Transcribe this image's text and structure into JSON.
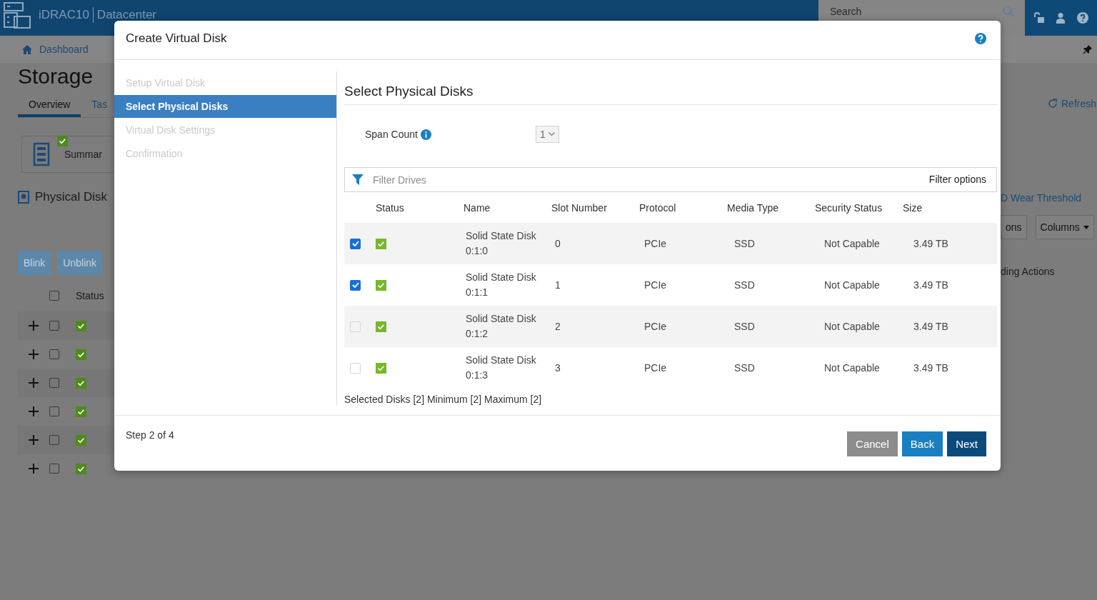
{
  "header": {
    "product": "iDRAC10",
    "edition": "Datacenter",
    "search": {
      "placeholder": "Search"
    }
  },
  "nav": {
    "items": [
      {
        "label": "Dashboard"
      }
    ]
  },
  "page": {
    "title": "Storage",
    "tabs": [
      {
        "label": "Overview",
        "selected": true
      },
      {
        "label": "Tas",
        "selected": false
      }
    ],
    "refresh": "Refresh",
    "summary_card": {
      "label": "Summar"
    },
    "section_title": "Physical Disk",
    "wear_link": "D Wear Threshold",
    "buttons": [
      "Blink",
      "Unblink"
    ],
    "right_buttons": [
      {
        "label": "ons",
        "kind": "plain"
      },
      {
        "label": "Columns",
        "kind": "dropdown"
      }
    ],
    "table": {
      "columns": [
        "Status",
        "ding Actions"
      ],
      "select_all": {
        "checked": false
      },
      "rows": [
        {
          "checked": false
        },
        {
          "checked": false
        },
        {
          "checked": false
        },
        {
          "checked": false
        },
        {
          "checked": false
        },
        {
          "checked": false
        }
      ]
    }
  },
  "dialog": {
    "title": "Create Virtual Disk",
    "steps": [
      {
        "label": "Setup Virtual Disk",
        "selected": false
      },
      {
        "label": "Select Physical Disks",
        "selected": true
      },
      {
        "label": "Virtual Disk Settings",
        "selected": false
      },
      {
        "label": "Confirmation",
        "selected": false
      }
    ],
    "section_title": "Select Physical Disks",
    "span_count": {
      "label": "Span Count",
      "value": "1"
    },
    "filter": {
      "placeholder": "Filter Drives",
      "options_label": "Filter options"
    },
    "table": {
      "columns": [
        "Status",
        "Name",
        "Slot Number",
        "Protocol",
        "Media Type",
        "Security Status",
        "Size"
      ],
      "rows": [
        {
          "checked": true,
          "disabled": false,
          "name": "Solid State Disk 0:1:0",
          "slot": "0",
          "protocol": "PCIe",
          "media_type": "SSD",
          "security_status": "Not Capable",
          "size": "3.49 TB"
        },
        {
          "checked": true,
          "disabled": false,
          "name": "Solid State Disk 0:1:1",
          "slot": "1",
          "protocol": "PCIe",
          "media_type": "SSD",
          "security_status": "Not Capable",
          "size": "3.49 TB"
        },
        {
          "checked": false,
          "disabled": true,
          "name": "Solid State Disk 0:1:2",
          "slot": "2",
          "protocol": "PCIe",
          "media_type": "SSD",
          "security_status": "Not Capable",
          "size": "3.49 TB"
        },
        {
          "checked": false,
          "disabled": true,
          "name": "Solid State Disk 0:1:3",
          "slot": "3",
          "protocol": "PCIe",
          "media_type": "SSD",
          "security_status": "Not Capable",
          "size": "3.49 TB"
        }
      ]
    },
    "selection_summary": "Selected Disks [2] Minimum [2] Maximum [2]",
    "step_indicator": "Step 2 of 4",
    "buttons": [
      {
        "label": "Cancel",
        "kind": "secondary"
      },
      {
        "label": "Back",
        "kind": "primary"
      },
      {
        "label": "Next",
        "kind": "dark"
      }
    ]
  }
}
